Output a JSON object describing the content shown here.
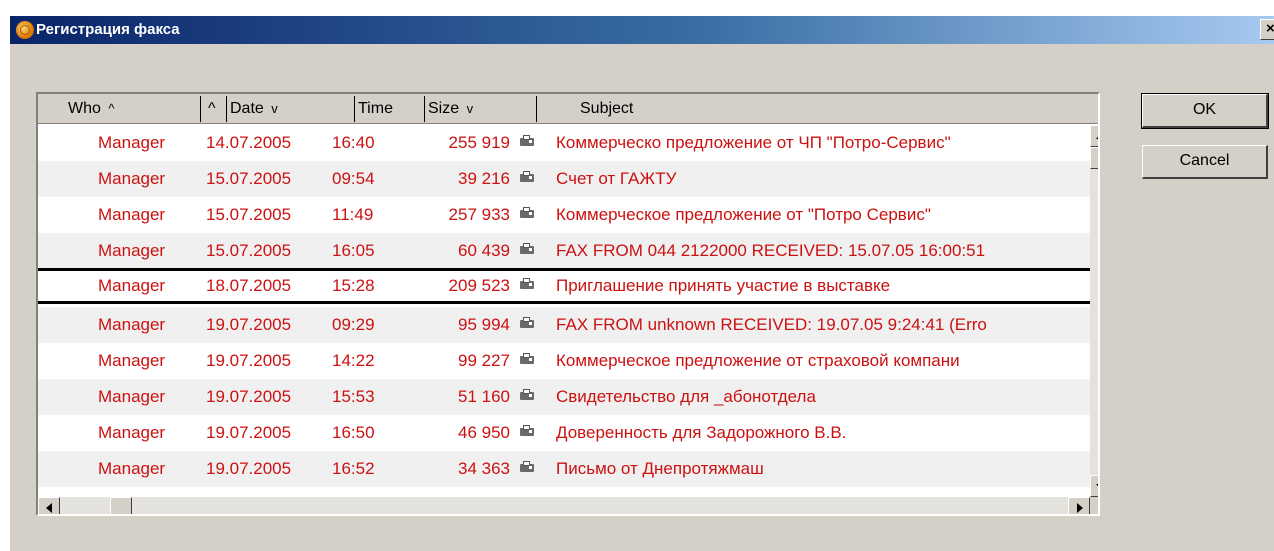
{
  "window": {
    "title": "Регистрация факса",
    "close_glyph": "×"
  },
  "columns": {
    "who": "Who",
    "date": "Date",
    "time": "Time",
    "size": "Size",
    "subject": "Subject",
    "sort_up": "^",
    "sort_down": "v"
  },
  "rows": [
    {
      "who": "Manager",
      "date": "14.07.2005",
      "time": "16:40",
      "size": "255 919",
      "subject": "Коммерческо предложение от ЧП  \"Потро-Сервис\""
    },
    {
      "who": "Manager",
      "date": "15.07.2005",
      "time": "09:54",
      "size": "39 216",
      "subject": "Счет от ГАЖТУ"
    },
    {
      "who": "Manager",
      "date": "15.07.2005",
      "time": "11:49",
      "size": "257 933",
      "subject": "Коммерческое предложение от \"Потро Сервис\""
    },
    {
      "who": "Manager",
      "date": "15.07.2005",
      "time": "16:05",
      "size": "60 439",
      "subject": "FAX FROM 044 2122000 RECEIVED: 15.07.05 16:00:51"
    },
    {
      "who": "Manager",
      "date": "18.07.2005",
      "time": "15:28",
      "size": "209 523",
      "subject": "Приглашение принять участие в выставке"
    },
    {
      "who": "Manager",
      "date": "19.07.2005",
      "time": "09:29",
      "size": "95 994",
      "subject": "FAX FROM unknown RECEIVED: 19.07.05 9:24:41 (Erro"
    },
    {
      "who": "Manager",
      "date": "19.07.2005",
      "time": "14:22",
      "size": "99 227",
      "subject": "Коммерческое предложение от страховой компани"
    },
    {
      "who": "Manager",
      "date": "19.07.2005",
      "time": "15:53",
      "size": "51 160",
      "subject": "Свидетельство для _абонотдела"
    },
    {
      "who": "Manager",
      "date": "19.07.2005",
      "time": "16:50",
      "size": "46 950",
      "subject": "Доверенность для Задорожного В.В."
    },
    {
      "who": "Manager",
      "date": "19.07.2005",
      "time": "16:52",
      "size": "34 363",
      "subject": "Письмо от Днепротяжмаш"
    }
  ],
  "selected_row": 5,
  "buttons": {
    "ok": "OK",
    "cancel": "Cancel"
  },
  "colors": {
    "row_text": "#cc1111",
    "titlebar_start": "#0a246a",
    "titlebar_end": "#a6caf0",
    "dialog_bg": "#d4d0c8"
  },
  "icons": {
    "row_icon": "fax-icon",
    "title_icon": "app-icon"
  }
}
